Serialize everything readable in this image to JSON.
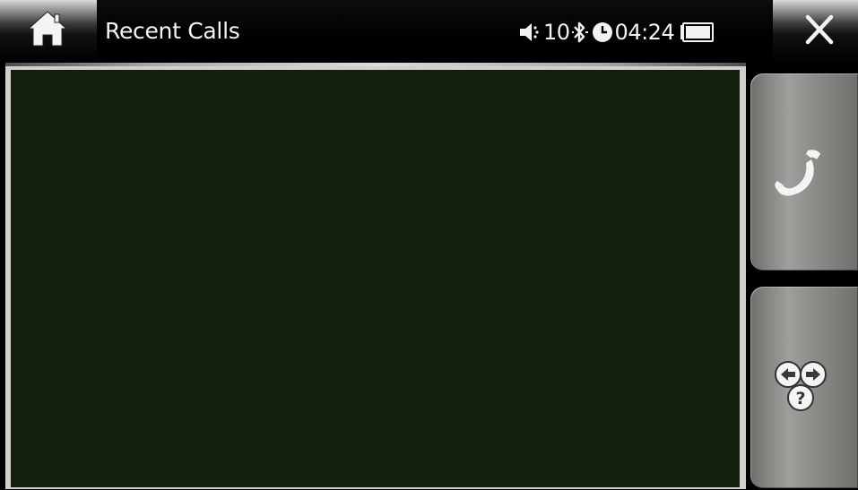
{
  "header": {
    "title": "Recent Calls",
    "volume_level": "10",
    "time": "04:24"
  },
  "icons": {
    "home": "home-icon",
    "volume": "speaker-icon",
    "bluetooth": "bluetooth-icon",
    "clock": "clock-icon",
    "battery": "battery-icon",
    "close": "close-icon",
    "call": "phone-handset-icon",
    "options": "navigation-help-icon"
  },
  "colors": {
    "list_background": "#141f0b",
    "button_silver": "#9da09b",
    "text": "#f4f4f4"
  }
}
